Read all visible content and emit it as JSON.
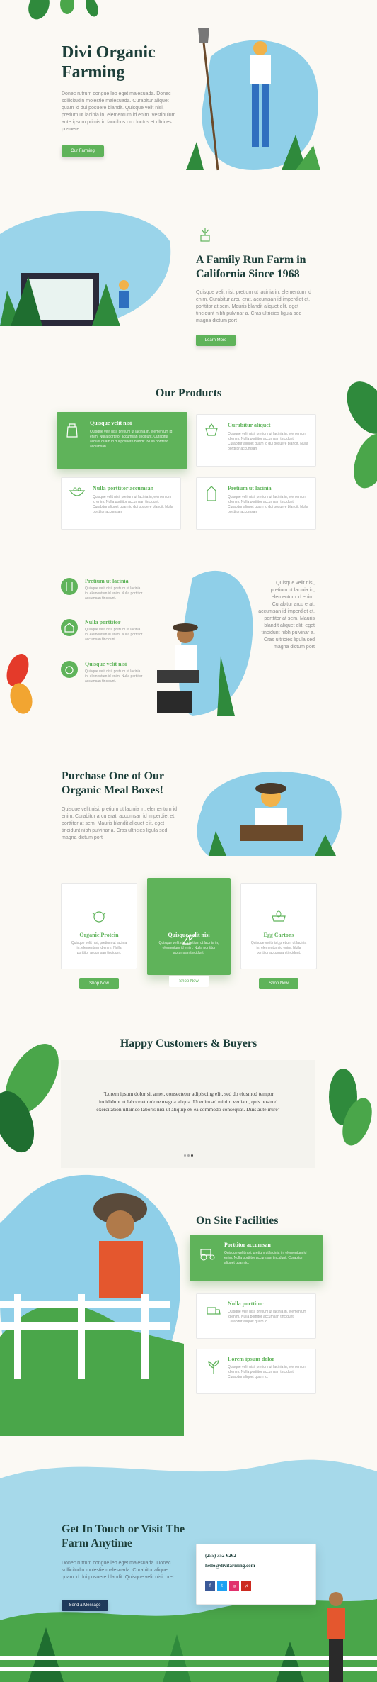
{
  "hero": {
    "title_line1": "Divi Organic",
    "title_line2": "Farming",
    "text": "Donec rutrum congue leo eget malesuada. Donec sollicitudin molestie malesuada. Curabitur aliquet quam id dui posuere blandit. Quisque velit nisi, pretium ut lacinia in, elementum id enim. Vestibulum ante ipsum primis in faucibus orci luctus et ultrices posuere.",
    "button": "Our Farming"
  },
  "about": {
    "title_line1": "A Family Run Farm in",
    "title_line2": "California Since 1968",
    "text": "Quisque velit nisi, pretium ut lacinia in, elementum id enim. Curabitur arcu erat, accumsan id imperdiet et, porttitor at sem. Mauris blandit aliquet elit, eget tincidunt nibh pulvinar a. Cras ultricies ligula sed magna dictum port",
    "button": "Learn More"
  },
  "products": {
    "title": "Our Products",
    "items": [
      {
        "title": "Quisque velit nisi",
        "text": "Quisque velit nisi, pretium ut lacinia in, elementum id enim. Nulla porttitor accumsan tincidunt. Curabitur aliquet quam id dui posuere blandit. Nulla porttitor accumsan"
      },
      {
        "title": "Curabitur aliquet",
        "text": "Quisque velit nisi, pretium ut lacinia in, elementum id enim. Nulla porttitor accumsan tincidunt. Curabitur aliquet quam id dui posuere blandit. Nulla porttitor accumsan"
      },
      {
        "title": "Nulla porttitor accumsan",
        "text": "Quisque velit nisi, pretium ut lacinia in, elementum id enim. Nulla porttitor accumsan tincidunt. Curabitur aliquet quam id dui posuere blandit. Nulla porttitor accumsan"
      },
      {
        "title": "Pretium ut lacinia",
        "text": "Quisque velit nisi, pretium ut lacinia in, elementum id enim. Nulla porttitor accumsan tincidunt. Curabitur aliquet quam id dui posuere blandit. Nulla porttitor accumsan"
      }
    ]
  },
  "features": {
    "items": [
      {
        "title": "Pretium ut lacinia",
        "text": "Quisque velit nisi, pretium ut lacinia in, elementum id enim. Nulla porttitor accumsan tincidunt."
      },
      {
        "title": "Nulla porttitor",
        "text": "Quisque velit nisi, pretium ut lacinia in, elementum id enim. Nulla porttitor accumsan tincidunt."
      },
      {
        "title": "Quisque velit nisi",
        "text": "Quisque velit nisi, pretium ut lacinia in, elementum id enim. Nulla porttitor accumsan tincidunt."
      }
    ],
    "side_text": "Quisque velit nisi, pretium ut lacinia in, elementum id enim. Curabitur arcu erat, accumsan id imperdiet et, porttitor at sem. Mauris blandit aliquet elit, eget tincidunt nibh pulvinar a. Cras ultricies ligula sed magna dictum port"
  },
  "boxes": {
    "title_line1": "Purchase One of Our",
    "title_line2": "Organic Meal Boxes!",
    "text": "Quisque velit nisi, pretium ut lacinia in, elementum id enim. Curabitur arcu erat, accumsan id imperdiet et, porttitor at sem. Mauris blandit aliquet elit, eget tincidunt nibh pulvinar a. Cras ultricies ligula sed magna dictum port",
    "items": [
      {
        "title": "Organic Protein",
        "text": "Quisque velit nisi, pretium ut lacinia in, elementum id enim. Nulla porttitor accumsan tincidunt.",
        "button": "Shop Now"
      },
      {
        "title": "Quisque velit nisi",
        "text": "Quisque velit nisi, pretium ut lacinia in, elementum id enim. Nulla porttitor accumsan tincidunt.",
        "button": "Shop Now"
      },
      {
        "title": "Egg Cartons",
        "text": "Quisque velit nisi, pretium ut lacinia in, elementum id enim. Nulla porttitor accumsan tincidunt.",
        "button": "Shop Now"
      }
    ]
  },
  "testimonials": {
    "title": "Happy Customers & Buyers",
    "quote": "\"Lorem ipsum dolor sit amet, consectetur adipiscing elit, sed do eiusmod tempor incididunt ut labore et dolore magna aliqua. Ut enim ad minim veniam, quis nostrud exercitation ullamco laboris nisi ut aliquip ex ea commodo consequat. Duis aute irure\""
  },
  "facilities": {
    "title": "On Site Facilities",
    "items": [
      {
        "title": "Porttitor accumsan",
        "text": "Quisque velit nisi, pretium ut lacinia in, elementum id enim. Nulla porttitor accumsan tincidunt. Curabitur aliquet quam id."
      },
      {
        "title": "Nulla porttitor",
        "text": "Quisque velit nisi, pretium ut lacinia in, elementum id enim. Nulla porttitor accumsan tincidunt. Curabitur aliquet quam id."
      },
      {
        "title": "Lorem ipsum dolor",
        "text": "Quisque velit nisi, pretium ut lacinia in, elementum id enim. Nulla porttitor accumsan tincidunt. Curabitur aliquet quam id."
      }
    ]
  },
  "contact": {
    "title_line1": "Get In Touch or Visit The",
    "title_line2": "Farm Anytime",
    "text": "Donec rutrum congue leo eget malesuada. Donec sollicitudin molestie malesuada. Curabitur aliquet quam id dui posuere blandit. Quisque velit nisi, pret",
    "button": "Send a Message",
    "phone": "(255) 352-6262",
    "email": "hello@divifarming.com",
    "social": [
      "f",
      "t",
      "ig",
      "yt"
    ]
  },
  "colors": {
    "green": "#5fb35a",
    "dark": "#1d3f3a",
    "navy": "#1f3a5b"
  }
}
